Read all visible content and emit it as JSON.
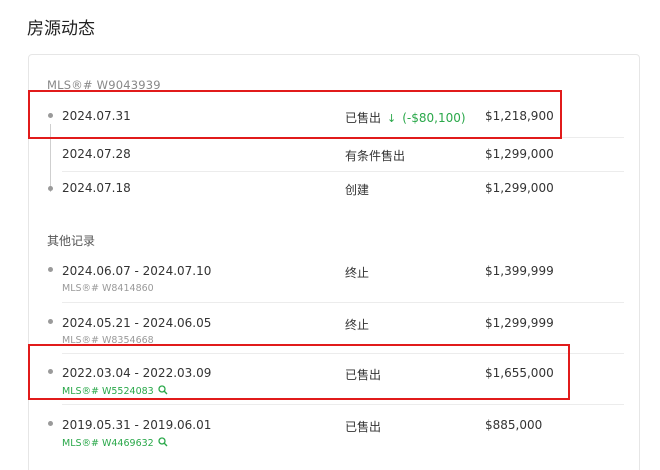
{
  "section_title": "房源动态",
  "current_listing": {
    "mls_label": "MLS®# W9043939",
    "events": [
      {
        "date": "2024.07.31",
        "status": "已售出",
        "arrow": "↓",
        "change": "(-$80,100)",
        "price": "$1,218,900"
      },
      {
        "date": "2024.07.28",
        "status": "有条件售出",
        "price": "$1,299,000"
      },
      {
        "date": "2024.07.18",
        "status": "创建",
        "price": "$1,299,000"
      }
    ]
  },
  "other_records": {
    "label": "其他记录",
    "items": [
      {
        "date": "2024.06.07 - 2024.07.10",
        "mls": "MLS®# W8414860",
        "status": "终止",
        "price": "$1,399,999"
      },
      {
        "date": "2024.05.21 - 2024.06.05",
        "mls": "MLS®# W8354668",
        "status": "终止",
        "price": "$1,299,999"
      },
      {
        "date": "2022.03.04 - 2022.03.09",
        "mls": "MLS®# W5524083",
        "status": "已售出",
        "price": "$1,655,000"
      },
      {
        "date": "2019.05.31 - 2019.06.01",
        "mls": "MLS®# W4469632",
        "status": "已售出",
        "price": "$885,000"
      }
    ]
  },
  "colors": {
    "accent_green": "#2aa84a",
    "highlight_red": "#e11b1b"
  }
}
